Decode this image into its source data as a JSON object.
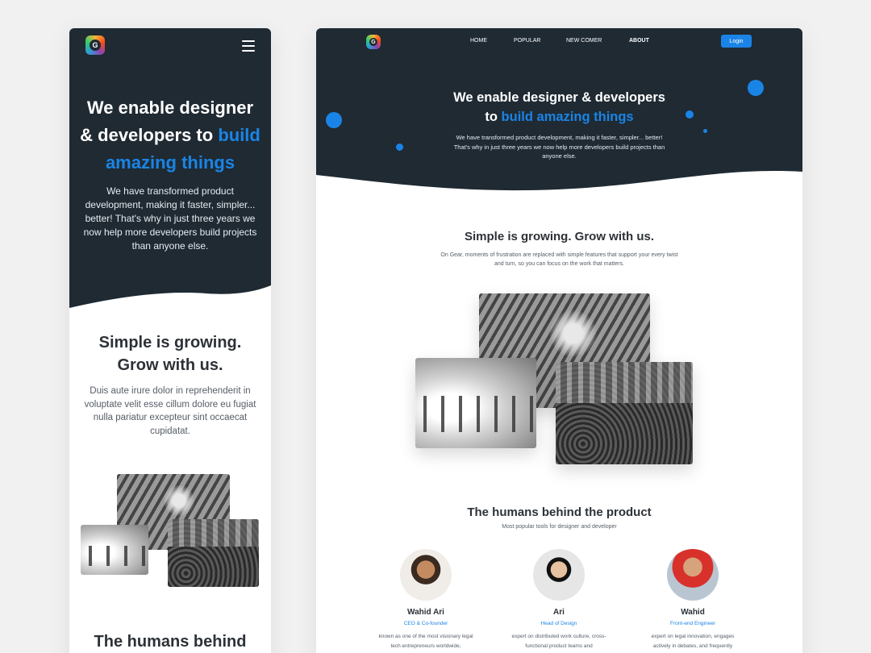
{
  "mobile": {
    "logo_letter": "G",
    "hero": {
      "title_line1": "We enable designer",
      "title_line2": "& developers to",
      "title_accent_a": "build",
      "title_accent_b": "amazing things",
      "subtitle": "We have transformed product development, making it faster, simpler... better! That's why in just three years we now help more developers build projects than anyone else."
    },
    "section": {
      "title_line1": "Simple is growing.",
      "title_line2": "Grow with us.",
      "body": "Duis aute irure dolor in reprehenderit in voluptate velit esse cillum dolore eu fugiat nulla pariatur excepteur sint occaecat cupidatat."
    },
    "team_title": "The humans behind"
  },
  "desktop": {
    "logo_letter": "G",
    "nav": [
      "HOME",
      "POPULAR",
      "NEW COMER",
      "ABOUT"
    ],
    "login_label": "Login",
    "hero": {
      "title_line1": "We enable designer & developers",
      "title_prefix": "to",
      "title_accent": "build amazing things",
      "subtitle": "We have transformed product development, making it faster, simpler... better! That's why in just three years we now help more developers build projects than anyone else."
    },
    "section": {
      "title": "Simple is growing. Grow with us.",
      "body": "On Gear, moments of frustration are replaced with simple features that support your every twist and turn, so you can focus on the work that matters."
    },
    "team": {
      "title": "The humans behind the product",
      "subtitle": "Most popular tools for designer and developer",
      "members": [
        {
          "name": "Wahid Ari",
          "role": "CEO & Co-founder",
          "desc": "known as one of the most visionary legal tech entrepreneurs worldwide,"
        },
        {
          "name": "Ari",
          "role": "Head of Design",
          "desc": "expert on distributed work culture, cross-functional product teams and"
        },
        {
          "name": "Wahid",
          "role": "Front-end Engineer",
          "desc": "expert on legal innovation, engages actively in debates, and frequently"
        }
      ]
    }
  },
  "colors": {
    "dark": "#1f2a33",
    "accent": "#1a84e6",
    "heading": "#2d3238"
  }
}
